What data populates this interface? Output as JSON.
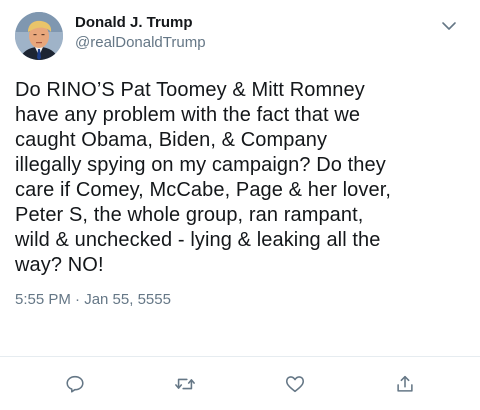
{
  "author": {
    "display_name": "Donald J. Trump",
    "handle": "@realDonaldTrump"
  },
  "tweet": {
    "text": "Do RINO’S Pat Toomey & Mitt Romney\nhave any problem with the fact that we\ncaught Obama, Biden, & Company\nillegally spying on my campaign? Do they\ncare if Comey, McCabe, Page & her lover,\nPeter S, the whole group, ran rampant,\nwild & unchecked - lying & leaking all the\nway? NO!",
    "timestamp": "5:55 PM · Jan 55, 5555"
  },
  "icons": {
    "menu": "chevron-down-icon",
    "reply": "reply-icon",
    "retweet": "retweet-icon",
    "like": "like-icon",
    "share": "share-icon"
  },
  "colors": {
    "text_primary": "#14171a",
    "text_secondary": "#657786",
    "icon": "#657786",
    "divider": "#e6ecf0"
  }
}
